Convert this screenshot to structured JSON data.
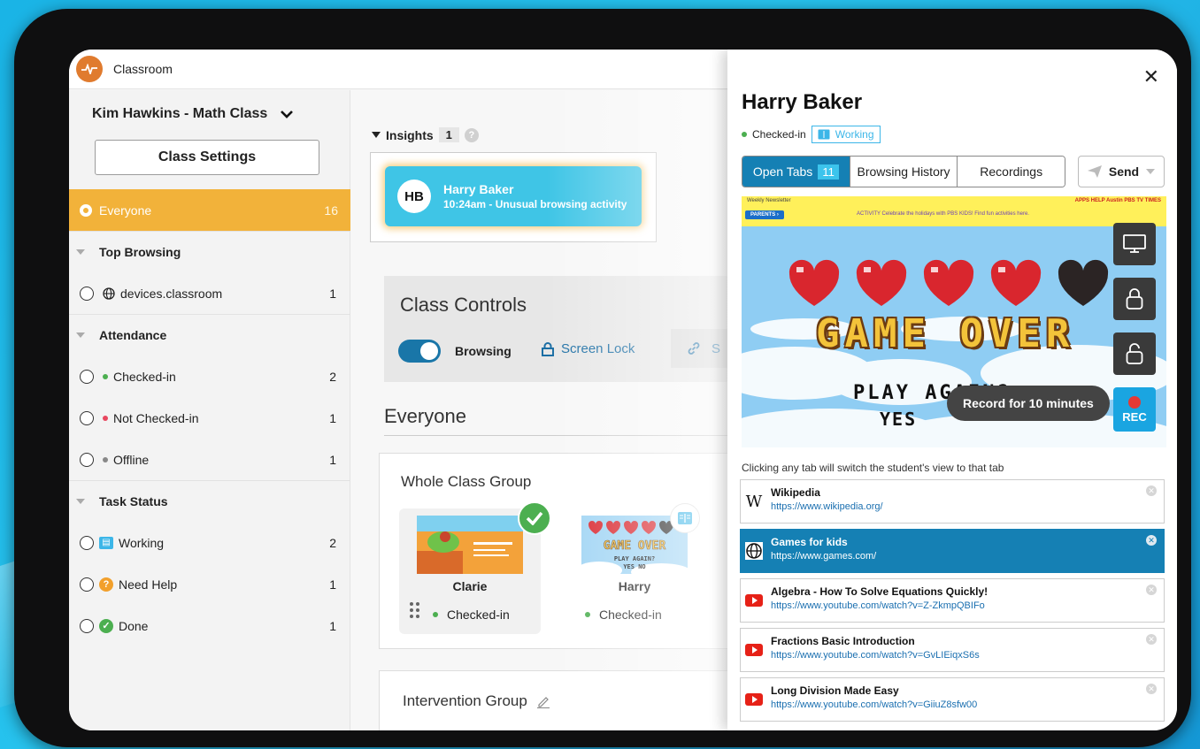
{
  "app": {
    "title": "Classroom"
  },
  "sidebar": {
    "class_name": "Kim Hawkins - Math Class",
    "settings_button": "Class Settings",
    "everyone": {
      "label": "Everyone",
      "count": "16"
    },
    "sections": [
      {
        "title": "Top Browsing",
        "rows": [
          {
            "label": "devices.classroom",
            "count": "1"
          }
        ]
      },
      {
        "title": "Attendance",
        "rows": [
          {
            "label": "Checked-in",
            "count": "2"
          },
          {
            "label": "Not Checked-in",
            "count": "1"
          },
          {
            "label": "Offline",
            "count": "1"
          }
        ]
      },
      {
        "title": "Task Status",
        "rows": [
          {
            "label": "Working",
            "count": "2"
          },
          {
            "label": "Need Help",
            "count": "1"
          },
          {
            "label": "Done",
            "count": "1"
          }
        ]
      }
    ]
  },
  "main": {
    "insights": {
      "label": "Insights",
      "count": "1"
    },
    "alert": {
      "initials": "HB",
      "name": "Harry Baker",
      "detail": "10:24am - Unusual browsing activity"
    },
    "controls": {
      "title": "Class Controls",
      "browsing_label": "Browsing",
      "browsing_on": true,
      "lock_label": "Screen Lock",
      "share_label": "S"
    },
    "everyone_title": "Everyone",
    "group1": {
      "title": "Whole Class Group",
      "students": [
        {
          "name": "Clarie",
          "status": "Checked-in"
        },
        {
          "name": "Harry",
          "status": "Checked-in"
        }
      ]
    },
    "group2": {
      "title": "Intervention Group"
    }
  },
  "panel": {
    "student_name": "Harry Baker",
    "status": "Checked-in",
    "task": "Working",
    "tabs": {
      "open": "Open Tabs",
      "open_count": "11",
      "history": "Browsing History",
      "recordings": "Recordings"
    },
    "send": "Send",
    "preview": {
      "site_header": "Weekly Newsletter",
      "site_links": "APPS  HELP  Austin PBS  TV TIMES",
      "parents_btn": "PARENTS ›",
      "activity_promo": "ACTIVITY  Celebrate the holidays with PBS KIDS! Find fun activities here.",
      "game_over": "GAME OVER",
      "play_again": "PLAY AGAIN?",
      "yes": "YES"
    },
    "record_tooltip": "Record for 10 minutes",
    "rec_label": "REC",
    "hint": "Clicking any tab will switch the student's view to that tab",
    "open_tabs": [
      {
        "title": "Wikipedia",
        "url": "https://www.wikipedia.org/",
        "icon": "wikipedia-icon",
        "active": false
      },
      {
        "title": "Games for kids",
        "url": "https://www.games.com/",
        "icon": "globe-icon",
        "active": true
      },
      {
        "title": "Algebra - How To Solve Equations Quickly!",
        "url": "https://www.youtube.com/watch?v=Z-ZkmpQBIFo",
        "icon": "youtube-icon",
        "active": false
      },
      {
        "title": "Fractions Basic Introduction",
        "url": "https://www.youtube.com/watch?v=GvLIEiqxS6s",
        "icon": "youtube-icon",
        "active": false
      },
      {
        "title": "Long Division Made Easy",
        "url": "https://www.youtube.com/watch?v=GiiuZ8sfw00",
        "icon": "youtube-icon",
        "active": false
      }
    ]
  },
  "colors": {
    "accent_orange": "#f2b23a",
    "primary_blue": "#1580b4",
    "alert_cyan": "#3fc5e6",
    "checked_green": "#4caf50",
    "not_checked_red": "#e8475f"
  }
}
